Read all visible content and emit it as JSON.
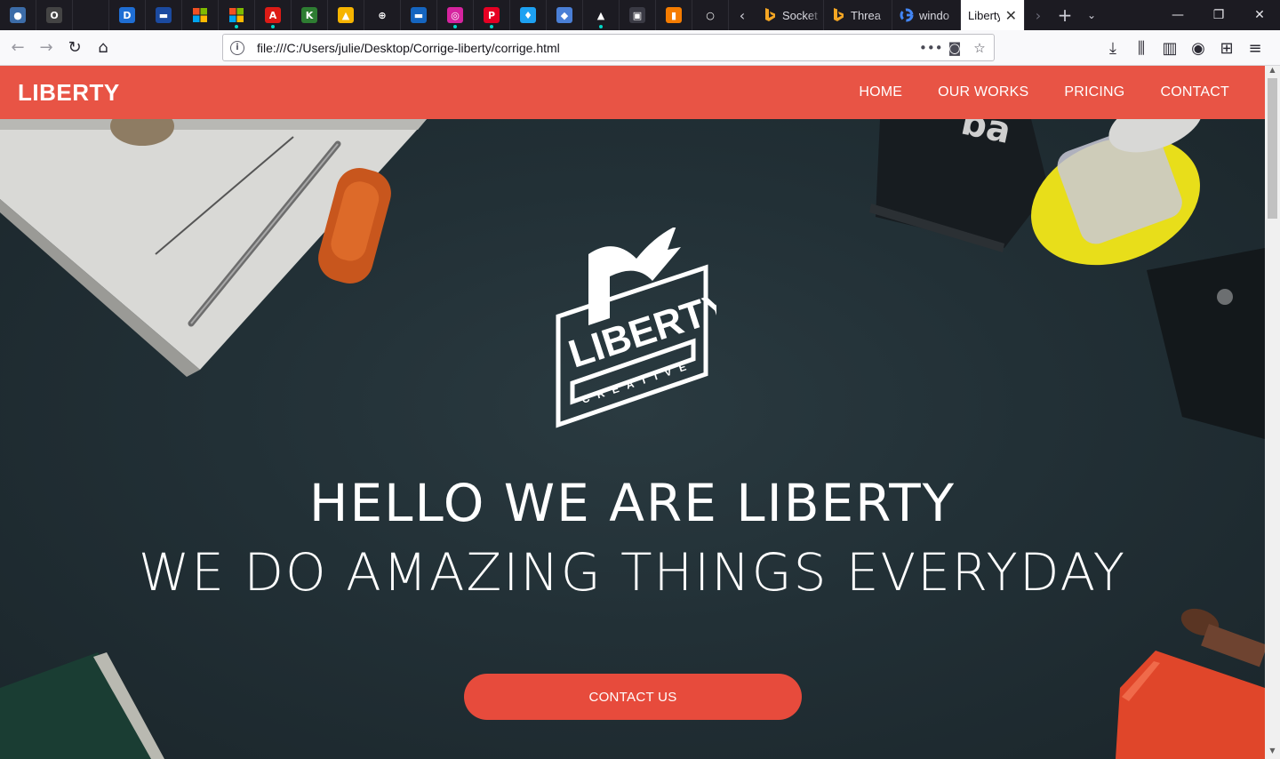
{
  "browser": {
    "pinned_tabs": [
      {
        "name": "pinned-tab-1",
        "glyph": "●",
        "color": "#3c6ca8"
      },
      {
        "name": "pinned-tab-2",
        "glyph": "O",
        "color": "#444444"
      },
      {
        "name": "pinned-tab-3",
        "glyph": "",
        "color": "#1c1b22"
      },
      {
        "name": "pinned-tab-dashlane",
        "glyph": "D",
        "color": "#1f6ed4"
      },
      {
        "name": "pinned-tab-5",
        "glyph": "▬",
        "color": "#1b4aa0"
      },
      {
        "name": "pinned-tab-microsoft-1",
        "glyph": "",
        "color": "ms"
      },
      {
        "name": "pinned-tab-microsoft-2",
        "glyph": "",
        "color": "ms"
      },
      {
        "name": "pinned-tab-angular",
        "glyph": "A",
        "color": "#dd1b16"
      },
      {
        "name": "pinned-tab-kle",
        "glyph": "K",
        "color": "#2e7d32"
      },
      {
        "name": "pinned-tab-yellow",
        "glyph": "▲",
        "color": "#f6b400"
      },
      {
        "name": "pinned-tab-globe",
        "glyph": "⊕",
        "color": "#1c1b22"
      },
      {
        "name": "pinned-tab-blue",
        "glyph": "▬",
        "color": "#1565c0"
      },
      {
        "name": "pinned-tab-instagram",
        "glyph": "◎",
        "color": "#d6249f"
      },
      {
        "name": "pinned-tab-pinterest",
        "glyph": "P",
        "color": "#e60023"
      },
      {
        "name": "pinned-tab-twitter",
        "glyph": "♦",
        "color": "#1da1f2"
      },
      {
        "name": "pinned-tab-bookmark",
        "glyph": "◆",
        "color": "#4a7fd6"
      },
      {
        "name": "pinned-tab-ads",
        "glyph": "▲",
        "color": "#1c1b22"
      },
      {
        "name": "pinned-tab-bag",
        "glyph": "▣",
        "color": "#3a3a44"
      },
      {
        "name": "pinned-tab-analytics",
        "glyph": "▮",
        "color": "#f57c00"
      },
      {
        "name": "pinned-tab-circle",
        "glyph": "○",
        "color": "#1c1b22"
      }
    ],
    "tabs": [
      {
        "title": "Socket",
        "icon": "bing-icon"
      },
      {
        "title": "Threa",
        "icon": "bing-icon"
      },
      {
        "title": "windo",
        "icon": "google-icon"
      }
    ],
    "active_tab": {
      "title": "Liberty",
      "close": "✕"
    },
    "url": "file:///C:/Users/julie/Desktop/Corrige-liberty/corrige.html"
  },
  "site": {
    "brand": "LIBERTY",
    "nav": [
      "HOME",
      "OUR WORKS",
      "PRICING",
      "CONTACT"
    ],
    "hero": {
      "logo_word": "LIBERTY",
      "logo_sub": "CREATIVE",
      "line1": "HELLO WE ARE LIBERTY",
      "line2": "WE DO AMAZING THINGS EVERYDAY",
      "cta": "CONTACT US"
    },
    "colors": {
      "accent": "#e85445",
      "hero_bg": "#223036"
    }
  }
}
